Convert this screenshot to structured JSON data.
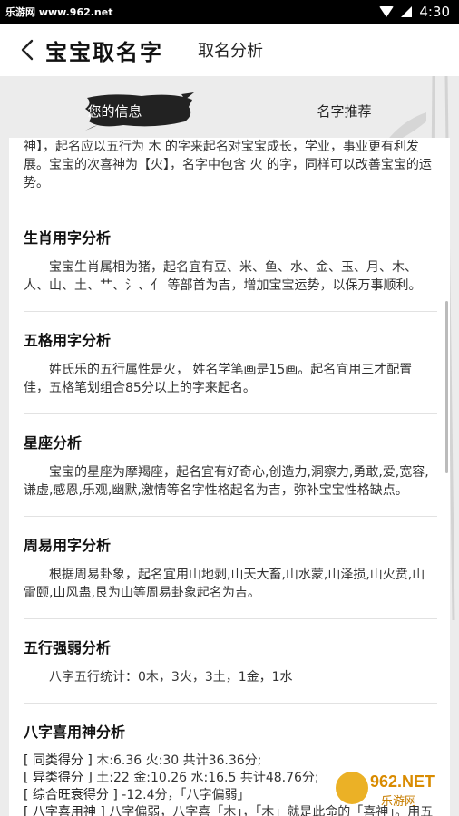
{
  "status_bar": {
    "site": "乐游网 www.962.net",
    "time": "4:30"
  },
  "header": {
    "title": "宝宝取名字",
    "subtitle": "取名分析"
  },
  "tabs": [
    {
      "label": "您的信息",
      "active": true
    },
    {
      "label": "名字推荐",
      "active": false
    }
  ],
  "intro": {
    "text": "神】，起名应以五行为 木 的字来起名对宝宝成长，学业，事业更有利发展。宝宝的次喜神为【火】，名字中包含 火 的字，同样可以改善宝宝的运势。"
  },
  "sections": {
    "zodiac": {
      "title": "生肖用字分析",
      "body": "宝宝生肖属相为猪，起名宜有豆、米、鱼、水、金、玉、月、木、人、山、土、艹、氵、亻 等部首为吉，增加宝宝运势，以保万事顺利。"
    },
    "wuge": {
      "title": "五格用字分析",
      "body": "姓氏乐的五行属性是火， 姓名学笔画是15画。起名宜用三才配置佳，五格笔划组合85分以上的字来起名。"
    },
    "star": {
      "title": "星座分析",
      "body": "宝宝的星座为摩羯座，起名宜有好奇心,创造力,洞察力,勇敢,爱,宽容,谦虚,感恩,乐观,幽默,激情等名字性格起名为吉，弥补宝宝性格缺点。"
    },
    "zhouyi": {
      "title": "周易用字分析",
      "body": "根据周易卦象，起名宜用山地剥,山天大畜,山水蒙,山泽损,山火贲,山雷颐,山风蛊,艮为山等周易卦象起名为吉。"
    },
    "wuxing": {
      "title": "五行强弱分析",
      "body": "八字五行统计：0木，3火，3土，1金，1水"
    },
    "xiyong": {
      "title": "八字喜用神分析",
      "lines": [
        {
          "tag": "[ 同类得分 ]",
          "text": " 木:6.36  火:30  共计36.36分;"
        },
        {
          "tag": "[ 异类得分 ]",
          "text": " 土:22  金:10.26  水:16.5  共计48.76分;"
        },
        {
          "tag": "[ 综合旺衰得分 ]",
          "text": " -12.4分，「八字偏弱」"
        },
        {
          "tag": "[ 八字喜用神 ]",
          "text": " 八字偏弱，八字喜「木」，「木」就是此命的「喜神」。用五行属 木 的字起名，对今后健康，事业，婚姻，财运都更加有利。"
        }
      ]
    }
  },
  "watermark": "962.NET 乐游网",
  "colors": {
    "status_bar": "#000000",
    "background": "#ececec",
    "card": "#ffffff",
    "active_tab_brush": "#222222"
  }
}
